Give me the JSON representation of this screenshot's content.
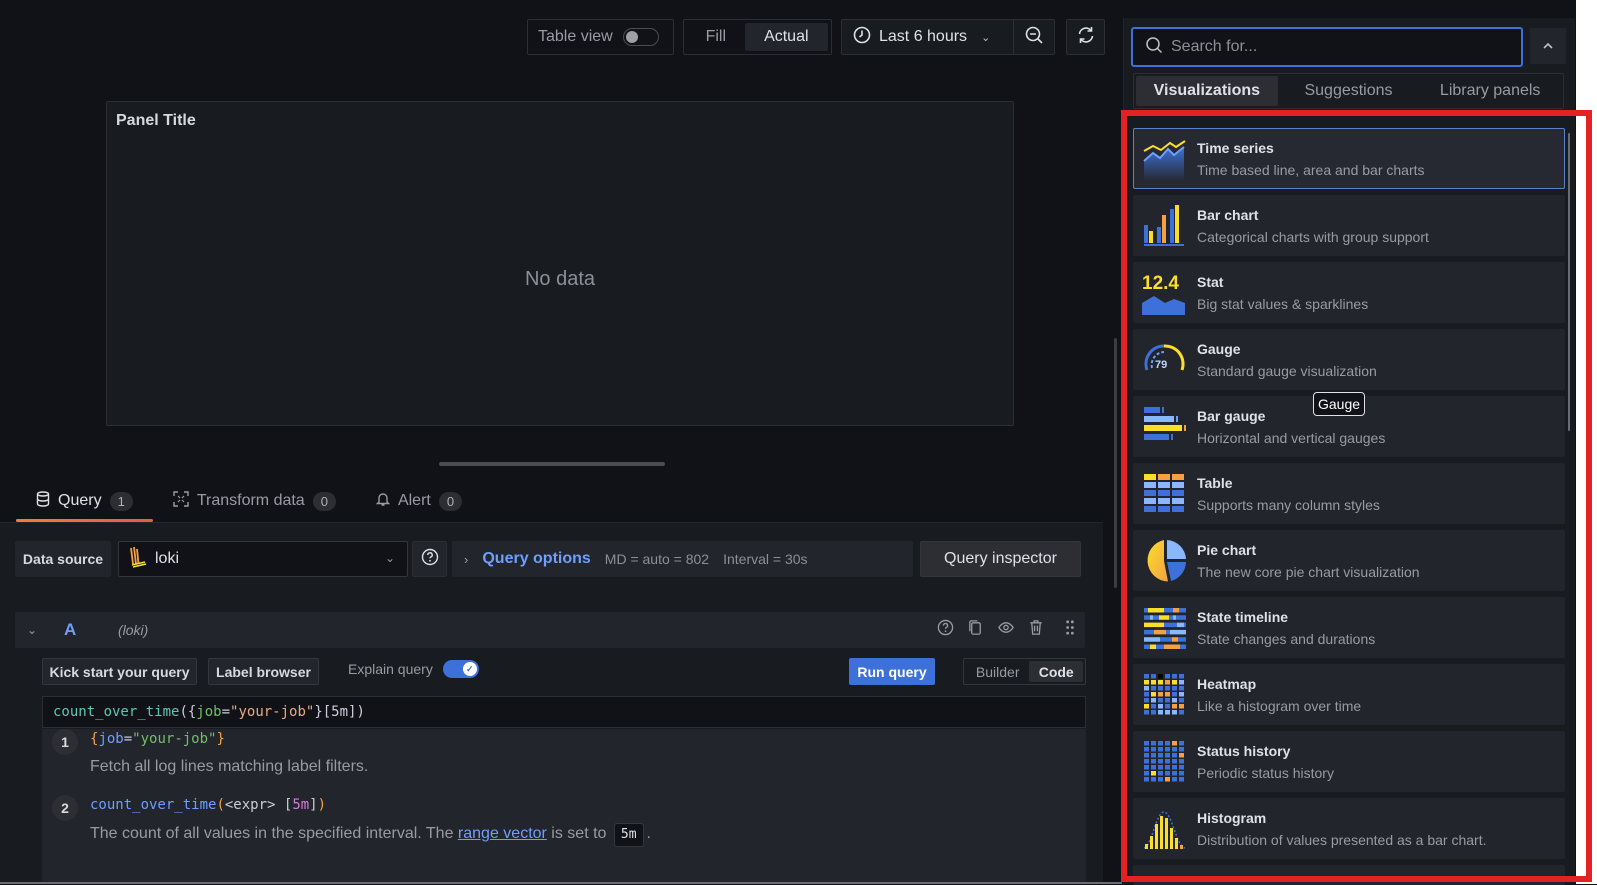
{
  "toolbar": {
    "table_view_label": "Table view",
    "table_view_on": false,
    "fill_label": "Fill",
    "actual_label": "Actual",
    "time_range": "Last 6 hours",
    "zoom_out_icon": "zoom-out-icon",
    "refresh_icon": "refresh-icon"
  },
  "panel": {
    "title": "Panel Title",
    "empty_message": "No data"
  },
  "tabs": [
    {
      "label": "Query",
      "count": "1",
      "icon": "database-icon",
      "active": true
    },
    {
      "label": "Transform data",
      "count": "0",
      "icon": "transform-icon",
      "active": false
    },
    {
      "label": "Alert",
      "count": "0",
      "icon": "bell-icon",
      "active": false
    }
  ],
  "datasource": {
    "label": "Data source",
    "selected": "loki"
  },
  "query_options": {
    "title": "Query options",
    "md": "MD = auto = 802",
    "interval": "Interval = 30s",
    "inspector_label": "Query inspector"
  },
  "query": {
    "ref_id": "A",
    "datasource_name": "(loki)",
    "kick_start_label": "Kick start your query",
    "label_browser_label": "Label browser",
    "explain_label": "Explain query",
    "explain_on": true,
    "run_label": "Run query",
    "builder_label": "Builder",
    "code_label": "Code",
    "mode": "Code",
    "code": {
      "fn": "count_over_time",
      "open": "({",
      "label": "job",
      "eq": "=",
      "value": "\"your-job\"",
      "close": "}[5m])"
    },
    "explain_steps": [
      {
        "num": "1",
        "expr": {
          "open": "{",
          "label": "job",
          "eq": "=",
          "value": "\"your-job\"",
          "close": "}"
        },
        "desc": "Fetch all log lines matching label filters."
      },
      {
        "num": "2",
        "expr": {
          "fn": "count_over_time",
          "open": "(",
          "arg": "<expr>",
          "range_open": " [",
          "range": "5m",
          "range_close": "]",
          "close": ")"
        },
        "desc_before": "The count of all values in the specified interval. The ",
        "link": "range vector",
        "desc_middle": " is set to ",
        "code": "5m",
        "desc_after": "."
      }
    ]
  },
  "visualization_picker": {
    "search_placeholder": "Search for...",
    "search_value": "",
    "tabs": [
      {
        "label": "Visualizations",
        "active": true
      },
      {
        "label": "Suggestions",
        "active": false
      },
      {
        "label": "Library panels",
        "active": false
      }
    ],
    "items": [
      {
        "name": "Time series",
        "desc": "Time based line, area and bar charts",
        "icon": "time-series-icon",
        "selected": true
      },
      {
        "name": "Bar chart",
        "desc": "Categorical charts with group support",
        "icon": "bar-chart-icon"
      },
      {
        "name": "Stat",
        "desc": "Big stat values & sparklines",
        "icon": "stat-icon",
        "icon_text": "12.4"
      },
      {
        "name": "Gauge",
        "desc": "Standard gauge visualization",
        "icon": "gauge-icon",
        "icon_text": "79"
      },
      {
        "name": "Bar gauge",
        "desc": "Horizontal and vertical gauges",
        "icon": "bar-gauge-icon"
      },
      {
        "name": "Table",
        "desc": "Supports many column styles",
        "icon": "table-icon"
      },
      {
        "name": "Pie chart",
        "desc": "The new core pie chart visualization",
        "icon": "pie-chart-icon"
      },
      {
        "name": "State timeline",
        "desc": "State changes and durations",
        "icon": "state-timeline-icon"
      },
      {
        "name": "Heatmap",
        "desc": "Like a histogram over time",
        "icon": "heatmap-icon"
      },
      {
        "name": "Status history",
        "desc": "Periodic status history",
        "icon": "status-history-icon"
      },
      {
        "name": "Histogram",
        "desc": "Distribution of values presented as a bar chart.",
        "icon": "histogram-icon"
      }
    ],
    "tooltip": "Gauge"
  },
  "colors": {
    "accent_blue": "#3d71d9",
    "link_blue": "#6e9fff",
    "yellow": "#fade2a",
    "orange": "#f5a142",
    "tab_underline": "#f57d35",
    "annotation_red": "#e32224"
  }
}
